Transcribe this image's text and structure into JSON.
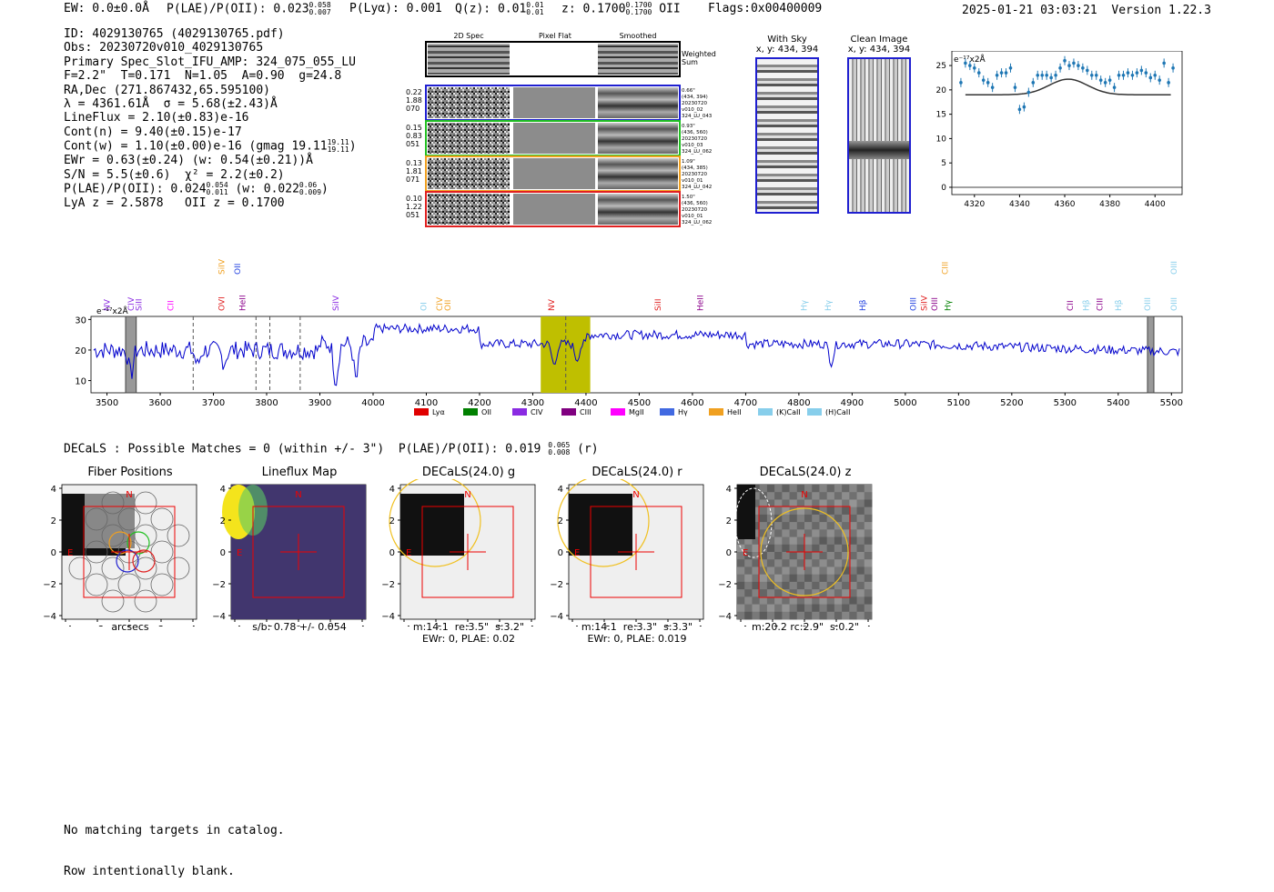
{
  "header": {
    "ew": "EW: 0.0±0.0Å",
    "plae_label": "P(LAE)/P(OII): 0.023",
    "plae_hi": "0.058",
    "plae_lo": "0.007",
    "plya": "P(Lyα): 0.001",
    "qz": "Q(z): 0.01",
    "qz_hi": "0.01",
    "qz_lo": "0.01",
    "z_label": "z: 0.1700",
    "z_hi": "0.1700",
    "z_lo": "0.1700",
    "z_type": "OII",
    "flags": "Flags:0x00400009",
    "datetime": "2025-01-21 03:03:21",
    "version": "Version 1.22.3"
  },
  "info": {
    "id": "ID: 4029130765 (4029130765.pdf)",
    "obs": "Obs: 20230720v010_4029130765",
    "primary": "Primary Spec_Slot_IFU_AMP: 324_075_055_LU",
    "fwhm_line": "F=2.2\"  T=0.171  N=1.05  A=0.90  g=24.8",
    "radec": "RA,Dec (271.867432,65.595100)",
    "lambda": "λ = 4361.61Å  σ = 5.68(±2.43)Å",
    "lineflux": "LineFlux = 2.10(±0.83)e-16",
    "contn": "Cont(n) = 9.40(±0.15)e-17",
    "contw": "Cont(w) = 1.10(±0.00)e-16 (gmag 19.11",
    "contw_hi": "19.11",
    "contw_lo": "19.11",
    "ewr": "EWr = 0.63(±0.24) (w: 0.54(±0.21))Å",
    "sn": "S/N = 5.5(±0.6)  χ² = 2.2(±0.2)",
    "plae2": "P(LAE)/P(OII): 0.024",
    "plae2_hi": "0.054",
    "plae2_lo": "0.011",
    "plae2_w": "(w: 0.022",
    "plae2_w_hi": "0.06",
    "plae2_w_lo": "0.009",
    "lyaz": "LyA z = 2.5878   OII z = 0.1700"
  },
  "cutouts": {
    "col_2d": "2D Spec",
    "col_flat": "Pixel Flat",
    "col_smooth": "Smoothed",
    "weighted": "Weighted\nSum",
    "rows": [
      {
        "left": [
          "0.22",
          "1.88",
          "070"
        ],
        "right": [
          "0.66\"",
          "(434, 394)",
          "20230720",
          "v010_02",
          "324_LU_043"
        ],
        "color": "#1f1fd0"
      },
      {
        "left": [
          "0.15",
          "0.83",
          "051"
        ],
        "right": [
          "0.93\"",
          "(436, 560)",
          "20230720",
          "v010_03",
          "324_LU_062"
        ],
        "color": "#22c022"
      },
      {
        "left": [
          "0.13",
          "1.81",
          "071"
        ],
        "right": [
          "1.09\"",
          "(434, 385)",
          "20230720",
          "v010_01",
          "324_LU_042"
        ],
        "color": "#f0a020"
      },
      {
        "left": [
          "0.10",
          "1.22",
          "051"
        ],
        "right": [
          "1.50\"",
          "(436, 560)",
          "20230720",
          "v010_01",
          "324_LU_062"
        ],
        "color": "#e02020"
      }
    ],
    "with_sky": "With Sky",
    "with_sky_xy": "x, y: 434, 394",
    "clean": "Clean Image",
    "clean_xy": "x, y: 434, 394"
  },
  "zoom_chart": {
    "unit": "e⁻¹⁷x2Å",
    "x_ticks": [
      "4320",
      "4340",
      "4360",
      "4380",
      "4400"
    ],
    "y_ticks": [
      "0",
      "5",
      "10",
      "15",
      "20",
      "25"
    ]
  },
  "spectrum": {
    "unit": "e⁻¹⁷x2Å",
    "x_ticks": [
      "3500",
      "3600",
      "3700",
      "3800",
      "3900",
      "4000",
      "4100",
      "4200",
      "4300",
      "4400",
      "4500",
      "4600",
      "4700",
      "4800",
      "4900",
      "5000",
      "5100",
      "5200",
      "5300",
      "5400",
      "5500"
    ],
    "y_ticks": [
      "10",
      "20",
      "30"
    ],
    "lines": [
      {
        "label": "NV",
        "w": 3500,
        "color": "#8a2be2",
        "row": 2
      },
      {
        "label": "CIV",
        "w": 3545,
        "color": "#8a2be2",
        "row": 2
      },
      {
        "label": "SiII",
        "w": 3560,
        "color": "#8a2be2",
        "row": 2
      },
      {
        "label": "CII",
        "w": 3620,
        "color": "#ff00ff",
        "row": 2
      },
      {
        "label": "SiIV",
        "w": 3715,
        "color": "#f0a020",
        "row": 0
      },
      {
        "label": "OII",
        "w": 3745,
        "color": "#2040e0",
        "row": 0
      },
      {
        "label": "OVI",
        "w": 3715,
        "color": "#e02020",
        "row": 2
      },
      {
        "label": "HeII",
        "w": 3755,
        "color": "#8b008b",
        "row": 2
      },
      {
        "label": "SiIV",
        "w": 3930,
        "color": "#8a2be2",
        "row": 2
      },
      {
        "label": "OI",
        "w": 4095,
        "color": "#87ceeb",
        "row": 2
      },
      {
        "label": "CIV",
        "w": 4125,
        "color": "#f0a020",
        "row": 2
      },
      {
        "label": "OII",
        "w": 4140,
        "color": "#f0a020",
        "row": 2
      },
      {
        "label": "NV",
        "w": 4335,
        "color": "#e02020",
        "row": 2
      },
      {
        "label": "SiII",
        "w": 4535,
        "color": "#e02020",
        "row": 2
      },
      {
        "label": "HeII",
        "w": 4615,
        "color": "#8b008b",
        "row": 2
      },
      {
        "label": "Hγ",
        "w": 4810,
        "color": "#87ceeb",
        "row": 2
      },
      {
        "label": "Hγ",
        "w": 4855,
        "color": "#87ceeb",
        "row": 2
      },
      {
        "label": "Hβ",
        "w": 4920,
        "color": "#2040e0",
        "row": 2
      },
      {
        "label": "OIII",
        "w": 5015,
        "color": "#2040e0",
        "row": 2
      },
      {
        "label": "SiIV",
        "w": 5035,
        "color": "#e02020",
        "row": 2
      },
      {
        "label": "OIII",
        "w": 5055,
        "color": "#8b008b",
        "row": 2
      },
      {
        "label": "Hγ",
        "w": 5080,
        "color": "#008000",
        "row": 2
      },
      {
        "label": "CIII",
        "w": 5075,
        "color": "#f0a020",
        "row": 0
      },
      {
        "label": "CII",
        "w": 5310,
        "color": "#8b008b",
        "row": 2
      },
      {
        "label": "Hβ",
        "w": 5340,
        "color": "#87ceeb",
        "row": 2
      },
      {
        "label": "CIII",
        "w": 5365,
        "color": "#8b008b",
        "row": 2
      },
      {
        "label": "Hβ",
        "w": 5400,
        "color": "#87ceeb",
        "row": 2
      },
      {
        "label": "OIII",
        "w": 5455,
        "color": "#87ceeb",
        "row": 2
      },
      {
        "label": "OIII",
        "w": 5505,
        "color": "#87ceeb",
        "row": 0
      },
      {
        "label": "OIII",
        "w": 5505,
        "color": "#87ceeb",
        "row": 2
      }
    ],
    "legend": [
      {
        "label": "Lyα",
        "color": "#e00000"
      },
      {
        "label": "OII",
        "color": "#008000"
      },
      {
        "label": "CIV",
        "color": "#8a2be2"
      },
      {
        "label": "CIII",
        "color": "#800080"
      },
      {
        "label": "MgII",
        "color": "#ff00ff"
      },
      {
        "label": "Hγ",
        "color": "#4169e1"
      },
      {
        "label": "HeII",
        "color": "#f0a020"
      },
      {
        "label": "(K)CaII",
        "color": "#87ceeb"
      },
      {
        "label": "(H)CaII",
        "color": "#87ceeb"
      }
    ]
  },
  "decals": {
    "line": "DECaLS : Possible Matches = 0 (within +/- 3\")  P(LAE)/P(OII): 0.019",
    "hi": "0.065",
    "lo": "0.008",
    "band": "(r)"
  },
  "panels": [
    {
      "title": "Fiber Positions",
      "cap1": "arcsecs",
      "cap2": ""
    },
    {
      "title": "Lineflux Map",
      "cap1": "s/b: 0.78 +/- 0.054",
      "cap2": ""
    },
    {
      "title": "DECaLS(24.0) g",
      "cap1": "m:14.1  re:3.5\"  s:3.2\"",
      "cap2": "EWr: 0, PLAE: 0.02"
    },
    {
      "title": "DECaLS(24.0) r",
      "cap1": "m:14.1  re:3.3\"  s:3.3\"",
      "cap2": "EWr: 0, PLAE: 0.019"
    },
    {
      "title": "DECaLS(24.0) z",
      "cap1": "m:20.2 rc:2.9\"  s:0.2\"",
      "cap2": ""
    }
  ],
  "panel_ticks": {
    "ticks": [
      "4",
      "2",
      "0",
      "−2",
      "−4"
    ],
    "xticks": [
      "−4",
      "−2",
      "0",
      "2",
      "4"
    ],
    "n": "N",
    "e": "E"
  },
  "footer": {
    "line1": "No matching targets in catalog.",
    "line2": "Row intentionally blank."
  },
  "chart_data": [
    {
      "type": "scatter",
      "title": "",
      "x": [
        4314,
        4316,
        4318,
        4320,
        4322,
        4324,
        4326,
        4328,
        4330,
        4332,
        4334,
        4336,
        4338,
        4340,
        4342,
        4344,
        4346,
        4348,
        4350,
        4352,
        4354,
        4356,
        4358,
        4360,
        4362,
        4364,
        4366,
        4368,
        4370,
        4372,
        4374,
        4376,
        4378,
        4380,
        4382,
        4384,
        4386,
        4388,
        4390,
        4392,
        4394,
        4396,
        4398,
        4400,
        4402,
        4404,
        4406,
        4408
      ],
      "y": [
        21.5,
        25.5,
        25,
        24.5,
        23.5,
        22,
        21.5,
        20.5,
        23,
        23.5,
        23.5,
        24.5,
        20.5,
        16,
        16.5,
        19.5,
        21.5,
        23,
        23,
        23,
        22.5,
        23,
        24.5,
        26,
        25,
        25.5,
        25,
        24.5,
        24,
        23,
        23,
        22,
        21.5,
        22,
        20.5,
        23,
        23,
        23.5,
        23,
        23.5,
        24,
        23.5,
        22.5,
        23,
        22,
        25.5,
        21.5,
        24.5
      ],
      "model_baseline": 19,
      "model_peak": 22.2,
      "model_center": 4361.6,
      "xlim": [
        4310,
        4412
      ],
      "ylim": [
        -1.5,
        28
      ]
    },
    {
      "type": "line",
      "title": "",
      "xlim": [
        3470,
        5520
      ],
      "ylim": [
        6,
        31
      ],
      "highlight_band": [
        4315,
        4408
      ],
      "dashed_lines": [
        3662,
        3780,
        3806,
        3863,
        4362
      ],
      "masked_regions": [
        [
          3535,
          3555
        ],
        [
          5455,
          5467
        ]
      ]
    }
  ]
}
